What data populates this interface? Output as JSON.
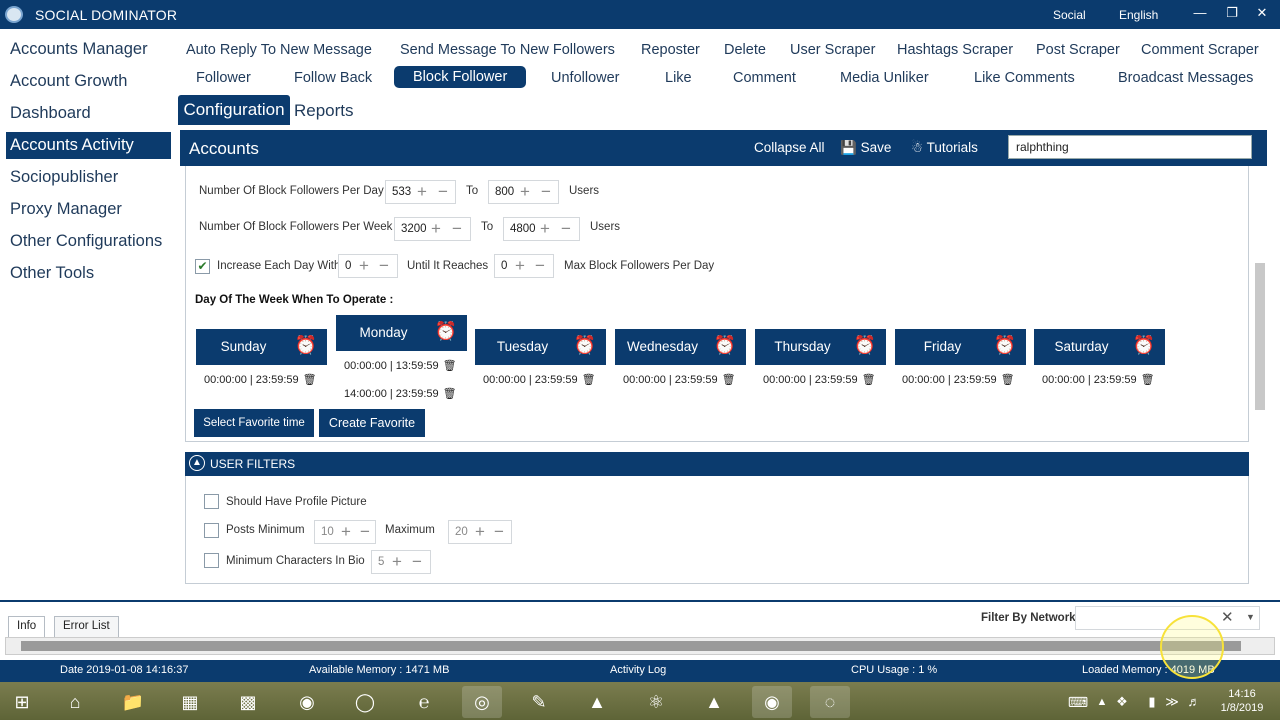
{
  "titlebar": {
    "app_name": "SOCIAL DOMINATOR",
    "menu_social": "Social",
    "menu_language": "English",
    "min": "—",
    "restore": "❐",
    "close": "✕"
  },
  "sidebar": {
    "items": [
      {
        "label": "Accounts Manager"
      },
      {
        "label": "Account Growth"
      },
      {
        "label": "Dashboard"
      },
      {
        "label": "Accounts Activity"
      },
      {
        "label": "Sociopublisher"
      },
      {
        "label": "Proxy Manager"
      },
      {
        "label": "Other Configurations"
      },
      {
        "label": "Other Tools"
      }
    ]
  },
  "tabs_row1": [
    {
      "label": "Auto Reply To New Message"
    },
    {
      "label": "Send Message To New Followers"
    },
    {
      "label": "Reposter"
    },
    {
      "label": "Delete"
    },
    {
      "label": "User Scraper"
    },
    {
      "label": "Hashtags Scraper"
    },
    {
      "label": "Post Scraper"
    },
    {
      "label": "Comment Scraper"
    }
  ],
  "tabs_row2": [
    {
      "label": "Follower"
    },
    {
      "label": "Follow Back"
    },
    {
      "label": "Block Follower"
    },
    {
      "label": "Unfollower"
    },
    {
      "label": "Like"
    },
    {
      "label": "Comment"
    },
    {
      "label": "Media Unliker"
    },
    {
      "label": "Like Comments"
    },
    {
      "label": "Broadcast Messages"
    }
  ],
  "subtabs": {
    "configuration": "Configuration",
    "reports": "Reports"
  },
  "accounts_bar": {
    "title": "Accounts",
    "collapse_all": "Collapse All",
    "save": "Save",
    "tutorials": "Tutorials",
    "search_value": "ralphthing"
  },
  "config": {
    "per_day_label": "Number Of Block Followers Per Day",
    "per_day_from": "533",
    "per_day_to": "800",
    "to_label": "To",
    "users_label": "Users",
    "per_week_label": "Number Of Block Followers Per Week",
    "per_week_from": "3200",
    "per_week_to": "4800",
    "increase_label": "Increase Each Day With",
    "increase_value": "0",
    "until_label": "Until It Reaches",
    "until_value": "0",
    "max_label": "Max Block Followers Per Day",
    "days_title": "Day Of The Week When To Operate :"
  },
  "days": [
    {
      "name": "Sunday",
      "slots": [
        "00:00:00 | 23:59:59"
      ]
    },
    {
      "name": "Monday",
      "slots": [
        "00:00:00 | 13:59:59",
        "14:00:00 | 23:59:59"
      ]
    },
    {
      "name": "Tuesday",
      "slots": [
        "00:00:00 | 23:59:59"
      ]
    },
    {
      "name": "Wednesday",
      "slots": [
        "00:00:00 | 23:59:59"
      ]
    },
    {
      "name": "Thursday",
      "slots": [
        "00:00:00 | 23:59:59"
      ]
    },
    {
      "name": "Friday",
      "slots": [
        "00:00:00 | 23:59:59"
      ]
    },
    {
      "name": "Saturday",
      "slots": [
        "00:00:00 | 23:59:59"
      ]
    }
  ],
  "buttons": {
    "select_favorite": "Select Favorite time",
    "create_favorite": "Create Favorite"
  },
  "user_filters": {
    "title": "USER FILTERS",
    "profile_pic": "Should Have Profile Picture",
    "posts": "Posts",
    "minimum": "Minimum",
    "min_value": "10",
    "maximum": "Maximum",
    "max_value": "20",
    "bio_chars": "Minimum Characters In Bio",
    "bio_value": "5"
  },
  "log": {
    "tab_info": "Info",
    "tab_errors": "Error List",
    "filter_label": "Filter By Network"
  },
  "status": {
    "date": "Date   2019-01-08 14:16:37",
    "avail_mem": "Available Memory :   1471 MB",
    "activity_log": "Activity Log",
    "cpu": "CPU Usage :   1 %",
    "loaded_mem": "Loaded Memory :   4019 MB"
  },
  "clock": {
    "time": "14:16",
    "date": "1/8/2019"
  },
  "colors": {
    "primary": "#0b3b6e"
  }
}
